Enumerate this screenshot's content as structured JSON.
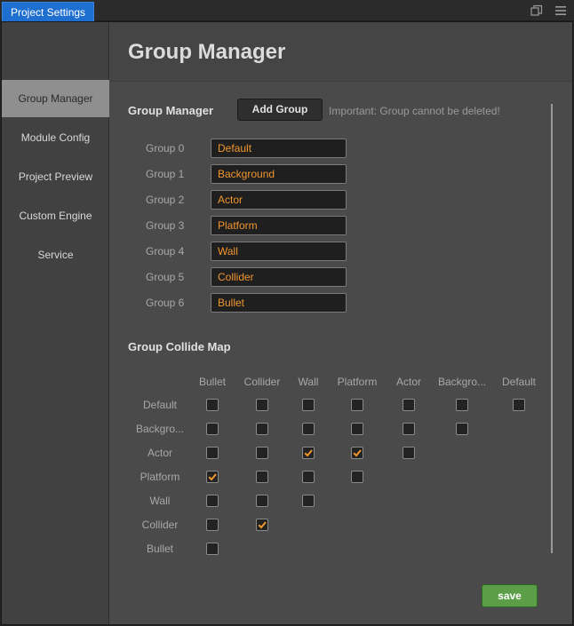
{
  "window": {
    "tab_title": "Project Settings",
    "icons": [
      "restore-window-icon",
      "menu-icon"
    ]
  },
  "sidebar": {
    "items": [
      {
        "label": "Group Manager",
        "active": true
      },
      {
        "label": "Module Config",
        "active": false
      },
      {
        "label": "Project Preview",
        "active": false
      },
      {
        "label": "Custom Engine",
        "active": false
      },
      {
        "label": "Service",
        "active": false
      }
    ]
  },
  "main": {
    "page_title": "Group Manager",
    "group_section_title": "Group Manager",
    "add_group_label": "Add Group",
    "notice": "Important: Group cannot be deleted!",
    "groups": [
      {
        "label": "Group 0",
        "value": "Default"
      },
      {
        "label": "Group 1",
        "value": "Background"
      },
      {
        "label": "Group 2",
        "value": "Actor"
      },
      {
        "label": "Group 3",
        "value": "Platform"
      },
      {
        "label": "Group 4",
        "value": "Wall"
      },
      {
        "label": "Group 5",
        "value": "Collider"
      },
      {
        "label": "Group 6",
        "value": "Bullet"
      }
    ],
    "collide_section_title": "Group Collide Map",
    "collide_columns": [
      "Bullet",
      "Collider",
      "Wall",
      "Platform",
      "Actor",
      "Backgro...",
      "Default"
    ],
    "collide_rows": [
      {
        "label": "Default",
        "checks": [
          false,
          false,
          false,
          false,
          false,
          false,
          false
        ]
      },
      {
        "label": "Backgro...",
        "checks": [
          false,
          false,
          false,
          false,
          false,
          false
        ]
      },
      {
        "label": "Actor",
        "checks": [
          false,
          false,
          true,
          true,
          false
        ]
      },
      {
        "label": "Platform",
        "checks": [
          true,
          false,
          false,
          false
        ]
      },
      {
        "label": "Wall",
        "checks": [
          false,
          false,
          false
        ]
      },
      {
        "label": "Collider",
        "checks": [
          false,
          true
        ]
      },
      {
        "label": "Bullet",
        "checks": [
          false
        ]
      }
    ],
    "save_label": "save"
  },
  "colors": {
    "tab_active": "#1e6fd0",
    "value_text": "#f0962e",
    "checkmark": "#f0962e",
    "save_button": "#5b9e47"
  }
}
